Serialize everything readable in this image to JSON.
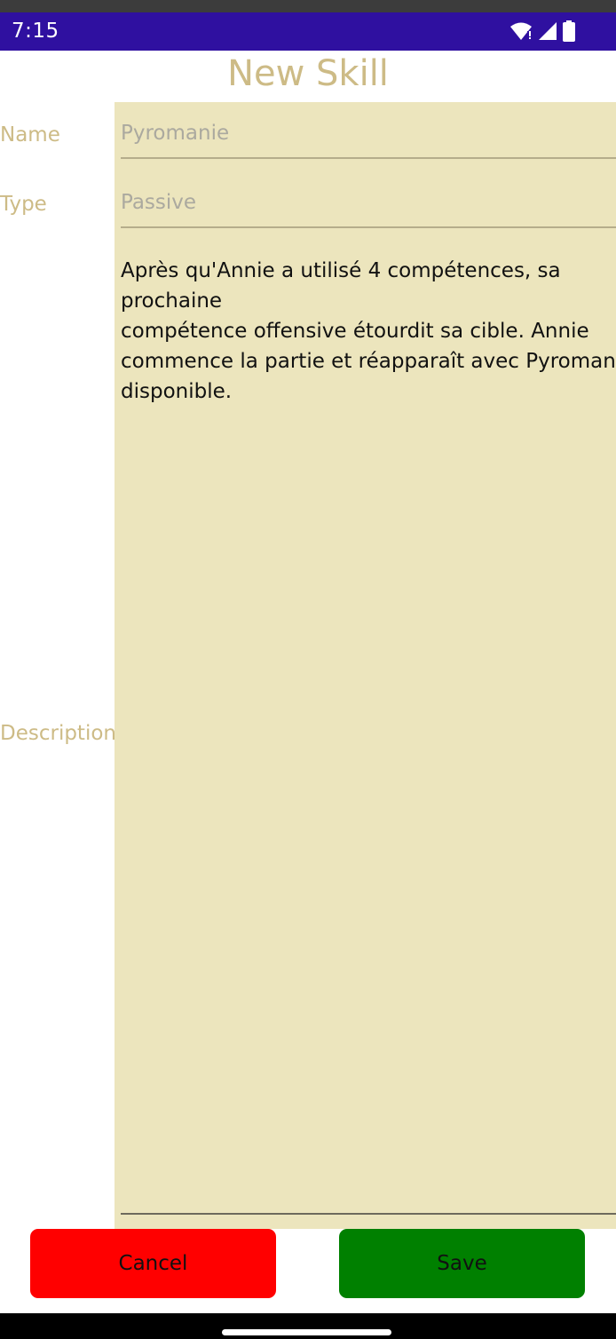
{
  "status_bar": {
    "time": "7:15",
    "icons": [
      "wifi-icon",
      "signal-icon",
      "battery-icon"
    ],
    "background": "#2f10a0"
  },
  "page": {
    "title": "New Skill"
  },
  "form": {
    "name_label": "Name",
    "name_placeholder": "Pyromanie",
    "type_label": "Type",
    "type_placeholder": "Passive",
    "description_label": "Description",
    "description_value": "Après qu'Annie a utilisé 4 compétences, sa prochaine\ncompétence offensive étourdit sa cible. Annie\ncommence la partie et réapparaît avec Pyromanie\ndisponible."
  },
  "buttons": {
    "cancel_label": "Cancel",
    "save_label": "Save"
  },
  "colors": {
    "label_gold": "#cdbb86",
    "panel_bg": "#ece5bd",
    "cancel_bg": "#ff0000",
    "save_bg": "#008000"
  }
}
